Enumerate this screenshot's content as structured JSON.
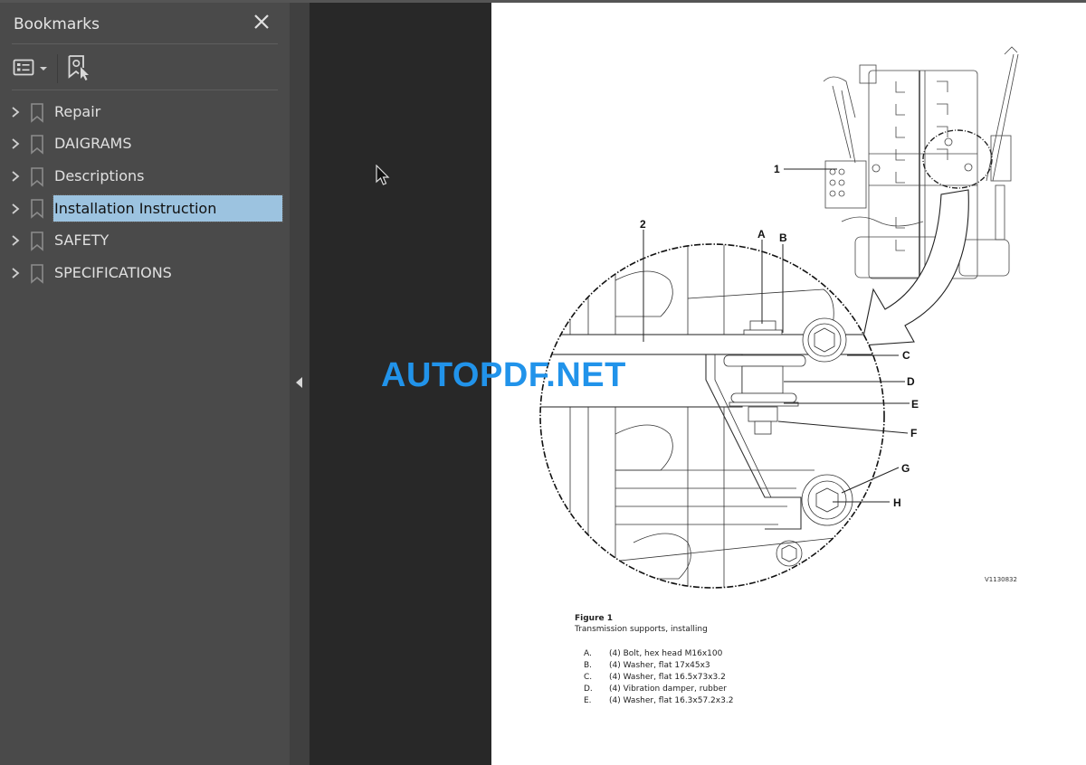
{
  "sidebar": {
    "title": "Bookmarks",
    "close_icon": "close-icon",
    "toolbar": {
      "options_icon": "list-options-icon",
      "dropdown_icon": "caret-down-icon",
      "find_bookmark_icon": "find-current-bookmark-icon"
    },
    "items": [
      {
        "label": "Repair",
        "selected": false
      },
      {
        "label": "DAIGRAMS",
        "selected": false
      },
      {
        "label": "Descriptions",
        "selected": false
      },
      {
        "label": "Installation Instruction",
        "selected": true
      },
      {
        "label": "SAFETY",
        "selected": false
      },
      {
        "label": "SPECIFICATIONS",
        "selected": false
      }
    ]
  },
  "splitter": {
    "collapse_icon": "triangle-left-icon"
  },
  "watermark": "AUTOPDF.NET",
  "document": {
    "figure": {
      "callouts": [
        "1",
        "2",
        "A",
        "B",
        "C",
        "D",
        "E",
        "F",
        "G",
        "H"
      ],
      "code": "V1130832",
      "title": "Figure 1",
      "subtitle": "Transmission supports, installing"
    },
    "parts": [
      {
        "letter": "A.",
        "text": "(4) Bolt, hex head M16x100"
      },
      {
        "letter": "B.",
        "text": "(4) Washer, flat 17x45x3"
      },
      {
        "letter": "C.",
        "text": "(4) Washer, flat 16.5x73x3.2"
      },
      {
        "letter": "D.",
        "text": "(4) Vibration damper, rubber"
      },
      {
        "letter": "E.",
        "text": "(4) Washer, flat 16.3x57.2x3.2"
      }
    ]
  },
  "colors": {
    "sidebar_bg": "#4a4a4a",
    "viewer_bg": "#282828",
    "selection": "#9cc3e0",
    "watermark": "#2193ea"
  }
}
